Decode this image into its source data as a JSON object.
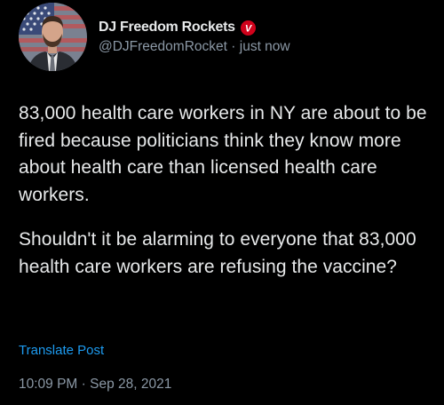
{
  "post": {
    "author": {
      "display_name": "DJ Freedom Rockets",
      "badge_letter": "V",
      "handle": "@DJFreedomRocket",
      "separator": "·",
      "relative_time": "just now"
    },
    "paragraphs": [
      "83,000 health care workers in NY are about to be fired because politicians think they know more about health care than licensed health care workers.",
      "Shouldn't it be alarming to everyone that 83,000 health care workers are refusing the vaccine?"
    ],
    "translate_label": "Translate Post",
    "time": "10:09 PM",
    "time_separator": "·",
    "date": "Sep 28, 2021"
  },
  "colors": {
    "background": "#000000",
    "primary_text": "#e7e9ea",
    "secondary_text": "#8b98a5",
    "link": "#1d9bf0",
    "badge": "#d0021b"
  },
  "icons": {
    "badge": "v-badge-icon",
    "avatar": "profile-photo"
  }
}
